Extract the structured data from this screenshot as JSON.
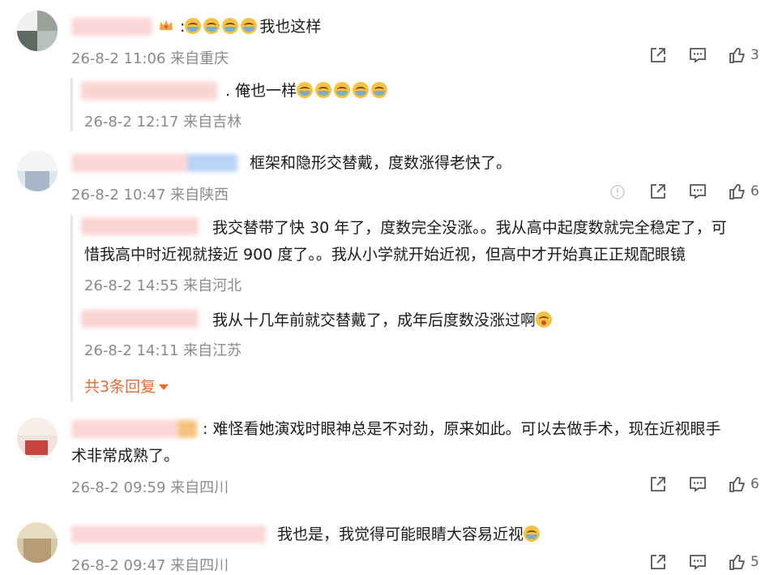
{
  "comments": [
    {
      "text": ":我也这样",
      "time": "26-8-2 11:06 来自重庆",
      "likes": "3",
      "replies": [
        {
          "text": ". 俺也一样",
          "time": "26-8-2 12:17 来自吉林"
        }
      ]
    },
    {
      "text": "框架和隐形交替戴，度数涨得老快了。",
      "time": "26-8-2 10:47 来自陕西",
      "likes": "6",
      "replies": [
        {
          "line1": "我交替带了快 30 年了，度数完全没涨。。我从高中起度数就完全稳定了，可",
          "line2": "惜我高中时近视就接近 900 度了。。我从小学就开始近视，但高中才开始真正正规配眼镜",
          "time": "26-8-2 14:55 来自河北"
        },
        {
          "text": "我从十几年前就交替戴了，成年后度数没涨过啊",
          "time": "26-8-2 14:11 来自江苏"
        }
      ],
      "more_replies": "共3条回复"
    },
    {
      "line1": ": 难怪看她演戏时眼神总是不对劲，原来如此。可以去做手术，现在近视眼手",
      "line2": "术非常成熟了。",
      "time": "26-8-2 09:59 来自四川",
      "likes": "6"
    },
    {
      "text": "我也是，我觉得可能眼睛大容易近视",
      "time": "26-8-2 09:47 来自四川",
      "likes": "5"
    }
  ],
  "icons": {
    "share": "share-icon",
    "comment": "comment-icon",
    "like": "thumbs-up-icon",
    "report": "report-icon",
    "crown": "vip-crown-icon",
    "emoji": "laugh-cry-emoji-icon"
  },
  "colors": {
    "accent": "#eb6a30",
    "meta": "#8a8a8a"
  }
}
